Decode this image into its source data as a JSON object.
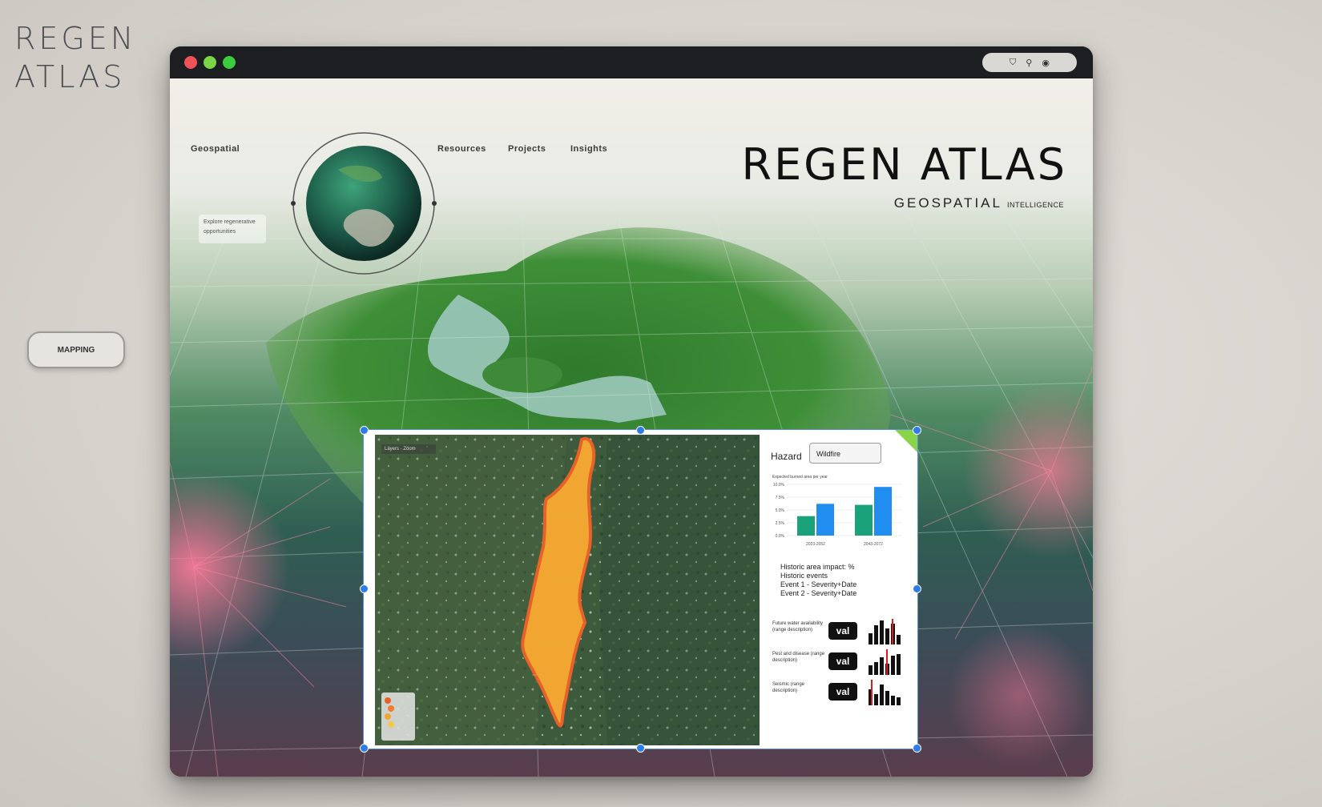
{
  "sidebar": {
    "logo_line1": "REGEN",
    "logo_line2": "ATLAS",
    "button_label": "MAPPING"
  },
  "header": {
    "nav": [
      "Geospatial",
      "Resources",
      "Projects",
      "Insights"
    ],
    "title": "REGEN ATLAS",
    "subtitle": "GEOSPATIAL",
    "subtitle_small": "INTELLIGENCE",
    "side_note_line1": "Explore regenerative",
    "side_note_line2": "opportunities"
  },
  "dashboard": {
    "hazard_label": "Hazard",
    "hazard_value": "Wildfire",
    "map_toolbar_label": "Layers · Zoom",
    "chart_title": "Expected burned area per year",
    "info_lines": [
      "Historic area impact: %",
      "Historic events",
      "Event 1 - Severity+Date",
      "Event 2 - Severity+Date"
    ],
    "metrics": [
      {
        "label": "Future water availability (range description)",
        "value": "val"
      },
      {
        "label": "Pest and disease (range description)",
        "value": "val"
      },
      {
        "label": "Seismic (range description)",
        "value": "val"
      }
    ]
  },
  "chart_data": {
    "type": "bar",
    "title": "Expected burned area per year",
    "categories": [
      "2023-2052",
      "2043-2072"
    ],
    "series": [
      {
        "values": [
          3.8,
          6.0
        ],
        "color": "#1aa37a"
      },
      {
        "values": [
          6.2,
          9.5
        ],
        "color": "#1f8ef0"
      }
    ],
    "ylim": [
      0,
      10
    ],
    "ytick_labels": [
      "0.0%",
      "2.5%",
      "5.0%",
      "7.5%",
      "10.0%"
    ],
    "ylabel": "",
    "xlabel": ""
  },
  "colors": {
    "accent": "#2f7be8",
    "hazard_high": "#e8602a",
    "hazard_mid": "#f0a630"
  }
}
